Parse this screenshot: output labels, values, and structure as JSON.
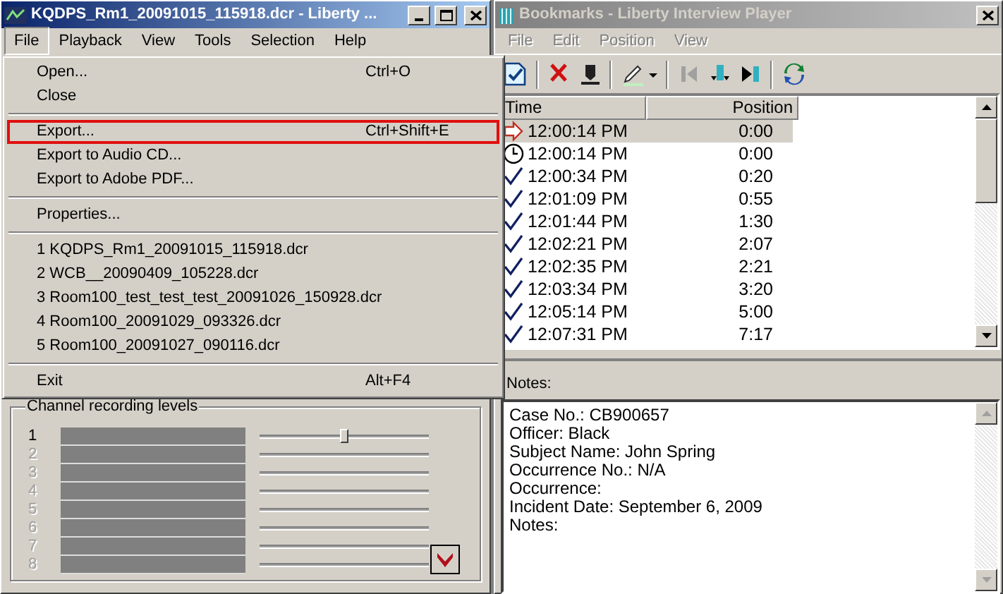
{
  "main_window": {
    "title": "KQDPS_Rm1_20091015_115918.dcr - Liberty ...",
    "active": true,
    "controls": [
      {
        "kind": "minimize"
      },
      {
        "kind": "maximize"
      },
      {
        "kind": "close"
      }
    ],
    "menu": [
      {
        "label": "File",
        "selected": true
      },
      {
        "label": "Playback",
        "selected": false
      },
      {
        "label": "View",
        "selected": false
      },
      {
        "label": "Tools",
        "selected": false
      },
      {
        "label": "Selection",
        "selected": false
      },
      {
        "label": "Help",
        "selected": false
      }
    ],
    "file_menu": [
      {
        "kind": "item",
        "label": "Open...",
        "shortcut": "Ctrl+O",
        "highlighted": false
      },
      {
        "kind": "item",
        "label": "Close",
        "highlighted": false
      },
      {
        "kind": "separator"
      },
      {
        "kind": "item",
        "label": "Export...",
        "shortcut": "Ctrl+Shift+E",
        "highlighted": true
      },
      {
        "kind": "item",
        "label": "Export to Audio CD...",
        "highlighted": false
      },
      {
        "kind": "item",
        "label": "Export to Adobe PDF...",
        "highlighted": false
      },
      {
        "kind": "separator"
      },
      {
        "kind": "item",
        "label": "Properties...",
        "highlighted": false
      },
      {
        "kind": "separator"
      },
      {
        "kind": "item",
        "label": "1 KQDPS_Rm1_20091015_115918.dcr",
        "highlighted": false
      },
      {
        "kind": "item",
        "label": "2 WCB__20090409_105228.dcr",
        "highlighted": false
      },
      {
        "kind": "item",
        "label": "3 Room100_test_test_test_20091026_150928.dcr",
        "highlighted": false
      },
      {
        "kind": "item",
        "label": "4 Room100_20091029_093326.dcr",
        "highlighted": false
      },
      {
        "kind": "item",
        "label": "5 Room100_20091027_090116.dcr",
        "highlighted": false
      },
      {
        "kind": "separator"
      },
      {
        "kind": "item",
        "label": "Exit",
        "shortcut": "Alt+F4",
        "highlighted": false
      }
    ],
    "channel_levels": {
      "title": "Channel recording levels",
      "channels": [
        {
          "number": "1",
          "enabled": true,
          "level": 0.5
        },
        {
          "number": "2",
          "enabled": false
        },
        {
          "number": "3",
          "enabled": false
        },
        {
          "number": "4",
          "enabled": false
        },
        {
          "number": "5",
          "enabled": false
        },
        {
          "number": "6",
          "enabled": false
        },
        {
          "number": "7",
          "enabled": false
        },
        {
          "number": "8",
          "enabled": false
        }
      ]
    }
  },
  "bookmarks_window": {
    "title": "Bookmarks - Liberty Interview Player",
    "active": false,
    "controls": [
      {
        "kind": "close"
      }
    ],
    "menu": [
      {
        "label": "File",
        "disabled": true
      },
      {
        "label": "Edit",
        "disabled": true
      },
      {
        "label": "Position",
        "disabled": true
      },
      {
        "label": "View",
        "disabled": true
      }
    ],
    "list": {
      "columns": [
        "Time",
        "Position"
      ],
      "rows": [
        {
          "kind": "arrow",
          "time": "12:00:14 PM",
          "position": "0:00",
          "selected": true
        },
        {
          "kind": "clock",
          "time": "12:00:14 PM",
          "position": "0:00",
          "selected": false
        },
        {
          "kind": "check",
          "time": "12:00:34 PM",
          "position": "0:20",
          "selected": false
        },
        {
          "kind": "check",
          "time": "12:01:09 PM",
          "position": "0:55",
          "selected": false
        },
        {
          "kind": "check",
          "time": "12:01:44 PM",
          "position": "1:30",
          "selected": false
        },
        {
          "kind": "check",
          "time": "12:02:21 PM",
          "position": "2:07",
          "selected": false
        },
        {
          "kind": "check",
          "time": "12:02:35 PM",
          "position": "2:21",
          "selected": false
        },
        {
          "kind": "check",
          "time": "12:03:34 PM",
          "position": "3:20",
          "selected": false
        },
        {
          "kind": "check",
          "time": "12:05:14 PM",
          "position": "5:00",
          "selected": false
        },
        {
          "kind": "check",
          "time": "12:07:31 PM",
          "position": "7:17",
          "selected": false
        }
      ]
    },
    "notes_label": "Notes:",
    "notes": [
      "Case No.: CB900657",
      "Officer: Black",
      "Subject Name: John Spring",
      "Occurrence No.: N/A",
      "Occurrence:",
      "Incident Date: September 6, 2009",
      "Notes:"
    ]
  }
}
